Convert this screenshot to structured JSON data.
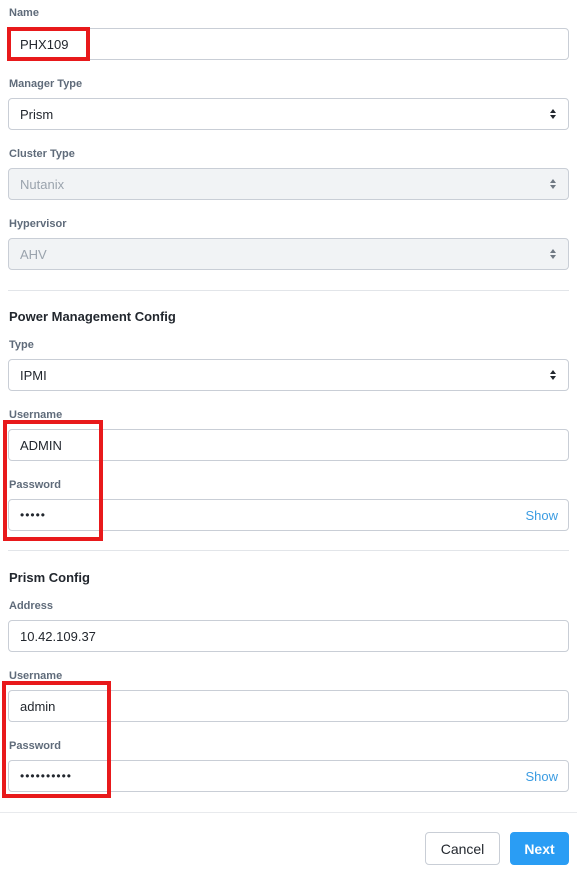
{
  "form": {
    "name": {
      "label": "Name",
      "value": "PHX109"
    },
    "manager_type": {
      "label": "Manager Type",
      "value": "Prism"
    },
    "cluster_type": {
      "label": "Cluster Type",
      "value": "Nutanix"
    },
    "hypervisor": {
      "label": "Hypervisor",
      "value": "AHV"
    }
  },
  "power_management": {
    "title": "Power Management Config",
    "type": {
      "label": "Type",
      "value": "IPMI"
    },
    "username": {
      "label": "Username",
      "value": "ADMIN"
    },
    "password": {
      "label": "Password",
      "value": "•••••",
      "show_label": "Show"
    }
  },
  "prism_config": {
    "title": "Prism Config",
    "address": {
      "label": "Address",
      "value": "10.42.109.37"
    },
    "username": {
      "label": "Username",
      "value": "admin"
    },
    "password": {
      "label": "Password",
      "value": "••••••••••",
      "show_label": "Show"
    }
  },
  "footer": {
    "cancel_label": "Cancel",
    "next_label": "Next"
  },
  "colors": {
    "highlight": "#e8191b",
    "primary": "#2a9df4",
    "link": "#3b9ce2"
  }
}
